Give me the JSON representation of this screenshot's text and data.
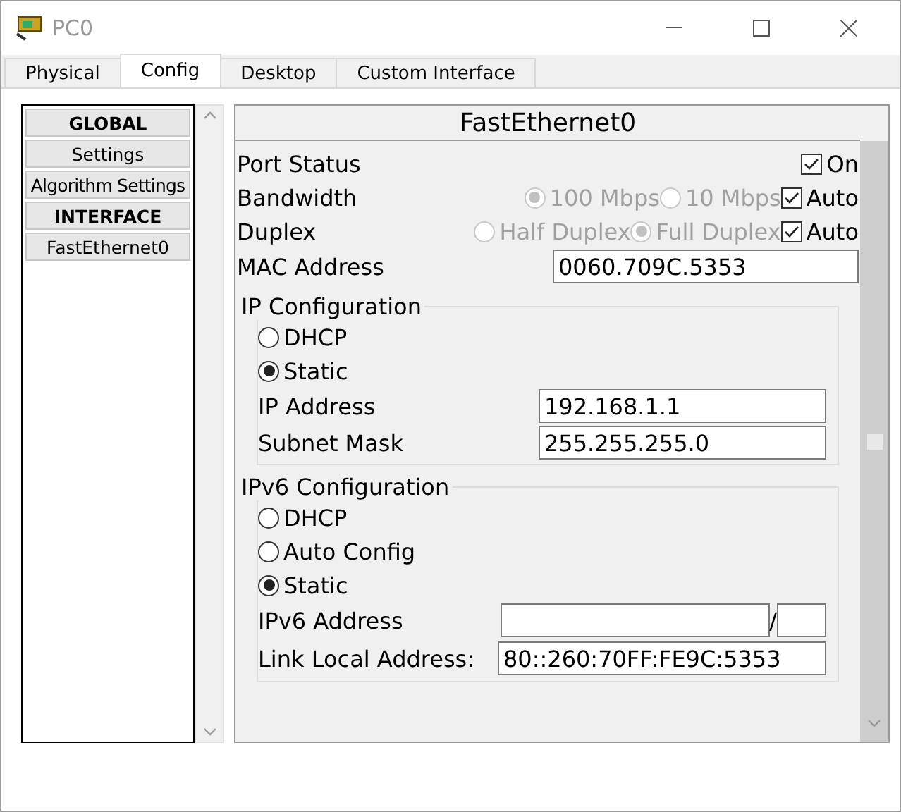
{
  "window": {
    "title": "PC0"
  },
  "tabs": [
    {
      "label": "Physical",
      "selected": false
    },
    {
      "label": "Config",
      "selected": true
    },
    {
      "label": "Desktop",
      "selected": false
    },
    {
      "label": "Custom Interface",
      "selected": false
    }
  ],
  "sidebar": {
    "items": [
      {
        "label": "GLOBAL",
        "kind": "header"
      },
      {
        "label": "Settings",
        "kind": "item"
      },
      {
        "label": "Algorithm Settings",
        "kind": "item"
      },
      {
        "label": "INTERFACE",
        "kind": "header"
      },
      {
        "label": "FastEthernet0",
        "kind": "item"
      }
    ]
  },
  "panel": {
    "title": "FastEthernet0",
    "port_status": {
      "label": "Port Status",
      "checkbox": {
        "label": "On",
        "checked": true
      }
    },
    "bandwidth": {
      "label": "Bandwidth",
      "disabled": true,
      "options": [
        {
          "label": "100 Mbps",
          "selected": true
        },
        {
          "label": "10 Mbps",
          "selected": false
        }
      ],
      "auto": {
        "label": "Auto",
        "checked": true
      }
    },
    "duplex": {
      "label": "Duplex",
      "disabled": true,
      "options": [
        {
          "label": "Half Duplex",
          "selected": false
        },
        {
          "label": "Full Duplex",
          "selected": true
        }
      ],
      "auto": {
        "label": "Auto",
        "checked": true
      }
    },
    "mac": {
      "label": "MAC Address",
      "value": "0060.709C.5353"
    },
    "ip_config": {
      "title": "IP Configuration",
      "modes": [
        {
          "label": "DHCP",
          "selected": false
        },
        {
          "label": "Static",
          "selected": true
        }
      ],
      "fields": [
        {
          "label": "IP Address",
          "value": "192.168.1.1"
        },
        {
          "label": "Subnet Mask",
          "value": "255.255.255.0"
        }
      ]
    },
    "ipv6_config": {
      "title": "IPv6 Configuration",
      "modes": [
        {
          "label": "DHCP",
          "selected": false
        },
        {
          "label": "Auto Config",
          "selected": false
        },
        {
          "label": "Static",
          "selected": true
        }
      ],
      "address": {
        "label": "IPv6 Address",
        "separator": "/"
      },
      "link_local": {
        "label": "Link Local Address:",
        "value": "80::260:70FF:FE9C:5353"
      }
    }
  }
}
